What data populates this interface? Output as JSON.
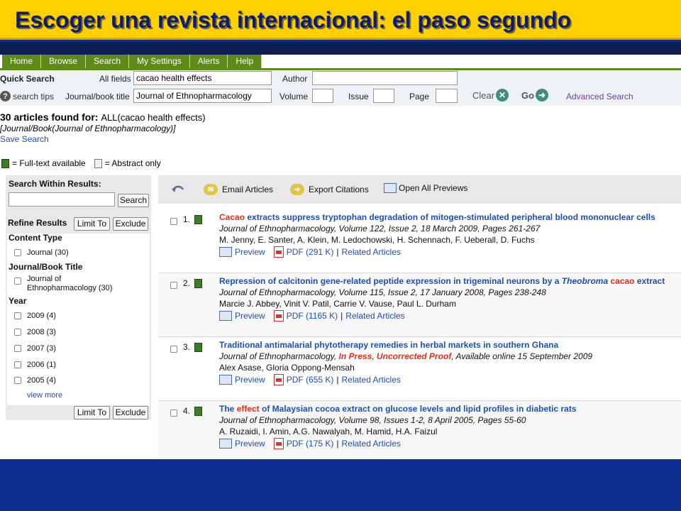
{
  "slide_title": "Escoger una revista internacional: el paso segundo",
  "nav": [
    "Home",
    "Browse",
    "Search",
    "My Settings",
    "Alerts",
    "Help"
  ],
  "quick_search": {
    "label": "Quick Search",
    "search_tips": "search tips",
    "all_fields_label": "All fields",
    "all_fields_value": "cacao health effects",
    "author_label": "Author",
    "author_value": "",
    "journal_label": "Journal/book title",
    "journal_value": "Journal of Ethnopharmacology",
    "volume_label": "Volume",
    "issue_label": "Issue",
    "page_label": "Page",
    "clear": "Clear",
    "go": "Go",
    "advanced": "Advanced Search"
  },
  "results_header": {
    "count": "30 articles found for:",
    "query": "ALL(cacao health effects)",
    "filter": "[Journal/Book(Journal of Ethnopharmacology)]",
    "save_search": "Save Search"
  },
  "legend": {
    "full_text": "= Full-text available",
    "abstract_only": "= Abstract only"
  },
  "left_panel": {
    "search_within": "Search Within Results:",
    "search_btn": "Search",
    "refine": "Refine Results",
    "limit_to": "Limit To",
    "exclude": "Exclude",
    "content_type": "Content Type",
    "journal_facet": "Journal (30)",
    "jb_title": "Journal/Book Title",
    "jb_line1": "Journal of",
    "jb_line2": "Ethnopharmacology (30)",
    "year": "Year",
    "years": [
      "2009 (4)",
      "2008 (3)",
      "2007 (3)",
      "2006 (1)",
      "2005 (4)"
    ],
    "view_more": "view more"
  },
  "toolbar": {
    "email": "Email Articles",
    "export": "Export Citations",
    "open_previews": "Open All Previews"
  },
  "results": [
    {
      "num": "1.",
      "title_hl": "Cacao",
      "title_rest": " extracts suppress tryptophan degradation of mitogen-stimulated peripheral blood mononuclear cells",
      "journal": "Journal of Ethnopharmacology, Volume 122, Issue 2, 18 March 2009, Pages 261-267",
      "authors": "M. Jenny, E. Santer, A. Klein, M. Ledochowski, H. Schennach, F. Ueberall, D. Fuchs",
      "preview": "Preview",
      "pdf": "PDF (291 K)",
      "related": "Related Articles"
    },
    {
      "num": "2.",
      "title_a": "Repression of calcitonin gene-related peptide expression in trigeminal neurons by a ",
      "title_i": "Theobroma",
      "title_hl": "cacao",
      "title_b": "extract",
      "journal": "Journal of Ethnopharmacology, Volume 115, Issue 2, 17 January 2008, Pages 238-248",
      "authors": "Marcie J. Abbey, Vinit V. Patil, Carrie V. Vause, Paul L. Durham",
      "preview": "Preview",
      "pdf": "PDF (1165 K)",
      "related": "Related Articles"
    },
    {
      "num": "3.",
      "title": "Traditional antimalarial phytotherapy remedies in herbal markets in southern Ghana",
      "journal_a": "Journal of Ethnopharmacology, ",
      "journal_ip": "In Press, Uncorrected Proof",
      "journal_b": ", Available online 15 September 2009",
      "authors": "Alex Asase, Gloria Oppong-Mensah",
      "preview": "Preview",
      "pdf": "PDF (655 K)",
      "related": "Related Articles"
    },
    {
      "num": "4.",
      "title_a": "The ",
      "title_hl": "effect",
      "title_b": " of Malaysian cocoa extract on glucose levels and lipid profiles in diabetic rats",
      "journal": "Journal of Ethnopharmacology, Volume 98, Issues 1-2, 8 April 2005, Pages 55-60",
      "authors": "A. Ruzaidi, I. Amin, A.G. Nawalyah, M. Hamid, H.A. Faizul",
      "preview": "Preview",
      "pdf": "PDF (175 K)",
      "related": "Related Articles"
    }
  ],
  "colors": {
    "slide_bg": "#0b2f93",
    "title_bar": "#ffd000",
    "nav_green": "#5e8a1a",
    "link_blue": "#1f4fb0",
    "highlight_red": "#e03020"
  }
}
